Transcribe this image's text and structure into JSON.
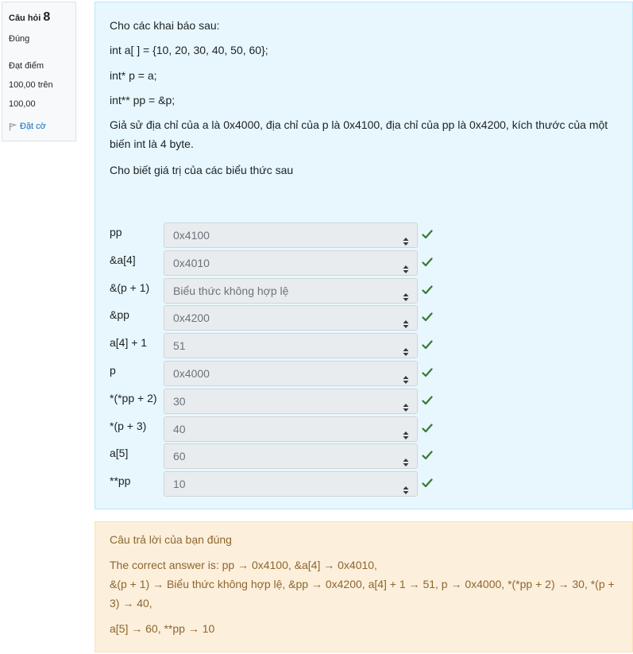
{
  "info": {
    "question_label": "Câu hỏi",
    "question_number": "8",
    "state": "Đúng",
    "grade_line1": "Đạt điểm",
    "grade_line2": "100,00 trên",
    "grade_line3": "100,00",
    "flag_label": "Đặt cờ"
  },
  "question": {
    "intro": "Cho các khai báo sau:",
    "code_line1": "int a[ ] = {10, 20, 30, 40, 50, 60};",
    "code_line2": "int* p = a;",
    "code_line3": "int** pp = &p;",
    "assumption": "Giả sử địa chỉ của a là 0x4000, địa chỉ của p là 0x4100, địa chỉ của pp là 0x4200, kích thước của một biến int là 4 byte.",
    "prompt": "Cho biết giá trị của các biểu thức sau",
    "rows": [
      {
        "label": "pp",
        "value": "0x4100"
      },
      {
        "label": "&a[4]",
        "value": "0x4010"
      },
      {
        "label": "&(p + 1)",
        "value": "Biểu thức không hợp lệ"
      },
      {
        "label": "&pp",
        "value": "0x4200"
      },
      {
        "label": "a[4] + 1",
        "value": "51"
      },
      {
        "label": "p",
        "value": "0x4000"
      },
      {
        "label": "*(*pp + 2)",
        "value": "30"
      },
      {
        "label": "*(p + 3)",
        "value": "40"
      },
      {
        "label": "a[5]",
        "value": "60"
      },
      {
        "label": "**pp",
        "value": "10"
      }
    ]
  },
  "feedback": {
    "status": "Câu trả lời của bạn đúng",
    "correct_line1": "The correct answer is: pp → 0x4100, &a[4] → 0x4010,",
    "correct_line2": "&(p + 1) → Biểu thức không hợp lệ, &pp → 0x4200, a[4] + 1 → 51, p → 0x4000, *(*pp + 2) → 30, *(p + 3) → 40,",
    "correct_line3": "a[5] → 60, **pp → 10"
  },
  "colors": {
    "check": "#357a32",
    "question_bg": "#e7f7fd",
    "feedback_bg": "#fcefdc",
    "feedback_text": "#8e662e",
    "flag_link": "#0f6cbf"
  },
  "icons": {
    "check": "check-icon",
    "flag": "flag-icon",
    "select_arrows": "updown-arrows-icon"
  }
}
